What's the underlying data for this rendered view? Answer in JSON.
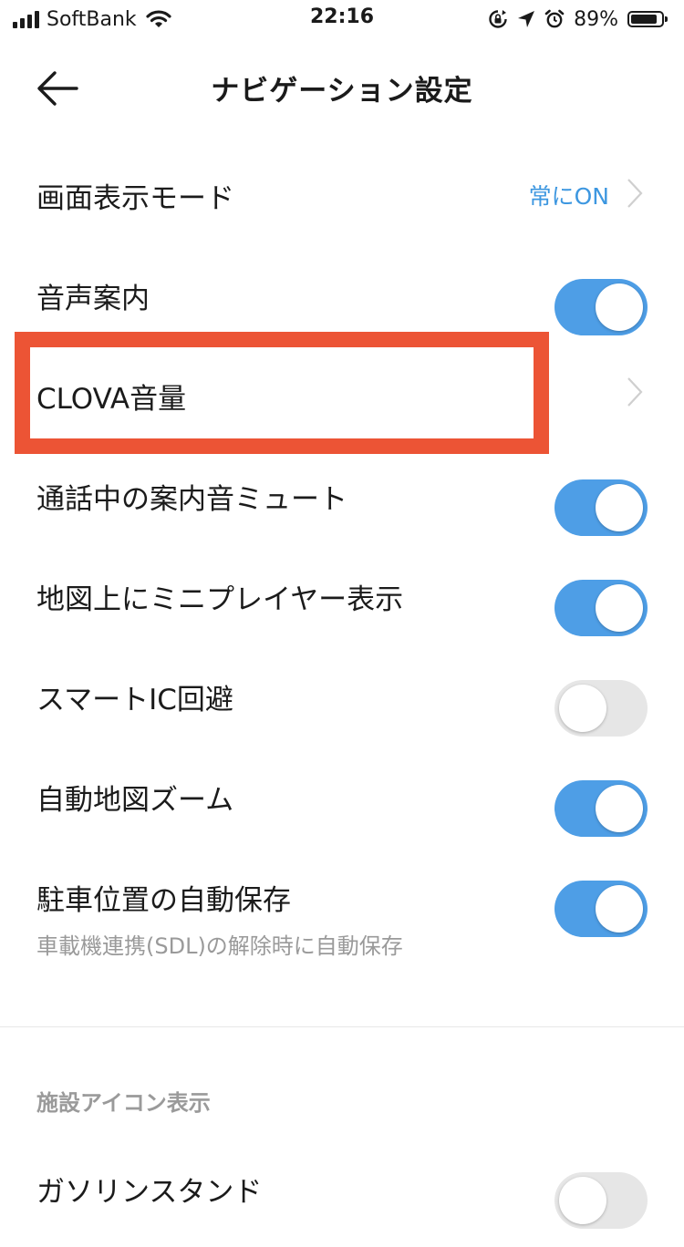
{
  "status_bar": {
    "carrier": "SoftBank",
    "time": "22:16",
    "battery_percent": "89%",
    "battery_level": 0.89,
    "icons": [
      "signal-icon",
      "wifi-icon",
      "rotation-lock-icon",
      "location-arrow-icon",
      "alarm-icon",
      "battery-icon"
    ]
  },
  "header": {
    "title": "ナビゲーション設定",
    "back_icon": "arrow-left-icon"
  },
  "settings": {
    "display_mode": {
      "label": "画面表示モード",
      "value": "常にON"
    },
    "voice_guidance": {
      "label": "音声案内",
      "toggle": true
    },
    "clova_volume": {
      "label": "CLOVA音量"
    },
    "mute_during_call": {
      "label": "通話中の案内音ミュート",
      "toggle": true
    },
    "mini_player": {
      "label": "地図上にミニプレイヤー表示",
      "toggle": true
    },
    "smart_ic": {
      "label": "スマートIC回避",
      "toggle": false
    },
    "auto_zoom": {
      "label": "自動地図ズーム",
      "toggle": true
    },
    "parking_save": {
      "label": "駐車位置の自動保存",
      "sublabel": "車載機連携(SDL)の解除時に自動保存",
      "toggle": true
    }
  },
  "facility_section": {
    "header": "施設アイコン表示",
    "gas_station": {
      "label": "ガソリンスタンド",
      "toggle": false
    }
  },
  "colors": {
    "accent": "#4e9ee6",
    "value_text": "#3d97e0",
    "highlight": "#ec5435",
    "toggle_off": "#e6e6e6"
  }
}
